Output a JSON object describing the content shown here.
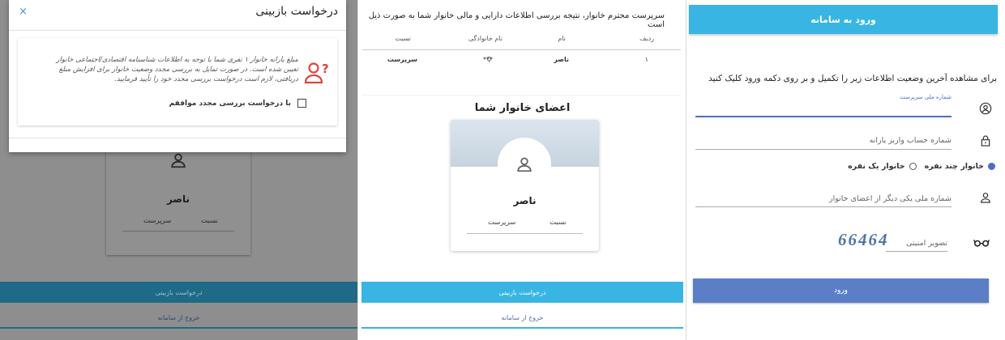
{
  "login": {
    "header": "ورود به سامانه",
    "intro": "برای مشاهده آخرین وضعیت اطلاعات زیر را تکمیل و بر روی دکمه ورود کلیک کنید",
    "national_id_label": "شماره ملی سرپرست",
    "account_placeholder": "شماره حساب واریز یارانه",
    "radio_family_one": "خانوار یک نفره",
    "radio_family_multi": "خانوار چند نفره",
    "other_member_placeholder": "شماره ملی یکی دیگر از اعضای خانوار",
    "captcha_label": "تصویر امنیتی",
    "captcha_value": "66464",
    "enter_button": "ورود"
  },
  "result": {
    "message": "سرپرست محترم خانوار، نتیجه بررسی اطلاعات دارایی و مالی خانوار شما به صورت ذیل است",
    "table": {
      "headers": [
        "ردیف",
        "نام",
        "نام خانوادگی",
        "نسبت"
      ],
      "rows": [
        [
          "۱",
          "ناصر",
          "***",
          "سرپرست"
        ]
      ]
    },
    "members_title": "اعضای خانوار شما",
    "card": {
      "name": "ناصر",
      "relation_label": "نسبت",
      "relation_value": "سرپرست"
    },
    "review_button": "درخواست بازبینی",
    "exit_button": "خروج از سامانه"
  },
  "dialog": {
    "title": "درخواست بازبینی",
    "close": "×",
    "text": "مبلغ یارانه خانوار ۱ نفری شما با توجه به اطلاعات شناسنامه اقتصادی/اجتماعی خانوار تعیین شده است. در صورت تمایل به بررسی مجدد وضعیت خانوار برای افزایش مبلغ دریافتی، لازم است درخواست بررسی مجدد خود را تأیید فرمایید.",
    "checkbox_label": "با درخواست بررسی مجدد موافقم",
    "bg_card": {
      "name": "ناصر",
      "relation_label": "نسبت",
      "relation_value": "سرپرست"
    },
    "bg_review_button": "درخواست بازبینی",
    "bg_exit_button": "خروج از سامانه"
  },
  "colors": {
    "accent": "#39b5e3",
    "primary_button": "#5b7ec7",
    "alert_icon": "#e0443c"
  }
}
